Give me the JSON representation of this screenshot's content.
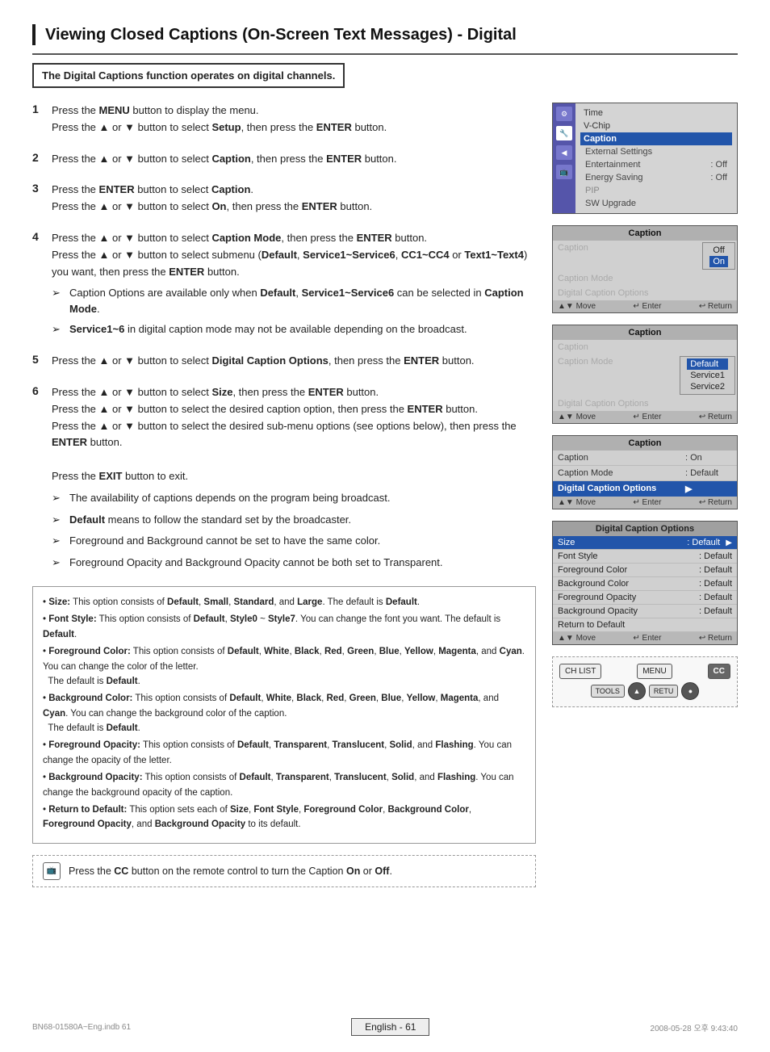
{
  "page": {
    "title": "Viewing Closed Captions (On-Screen Text Messages) - Digital",
    "subtitle": "The Digital Captions function operates on digital channels.",
    "page_number": "English - 61",
    "footer_left": "BN68-01580A~Eng.indb   61",
    "footer_right": "2008-05-28   오후 9:43:40"
  },
  "steps": [
    {
      "num": "1",
      "text": "Press the MENU button to display the menu.\nPress the ▲ or ▼ button to select Setup, then press the ENTER button."
    },
    {
      "num": "2",
      "text": "Press the ▲ or ▼ button to select Caption, then press the ENTER button."
    },
    {
      "num": "3",
      "text": "Press the ENTER button to select Caption.\nPress the ▲ or ▼ button to select On, then press the ENTER button."
    },
    {
      "num": "4",
      "text": "Press the ▲ or ▼ button to select Caption Mode, then press the ENTER button.\nPress the ▲ or ▼ button to select submenu (Default, Service1~Service6, CC1~CC4 or Text1~Text4) you want, then press the ENTER button.",
      "bullets": [
        "Caption Options are available only when Default, Service1~Service6 can be selected in Caption Mode.",
        "Service1~6 in digital caption mode may not be available depending on the broadcast."
      ]
    },
    {
      "num": "5",
      "text": "Press the ▲ or ▼ button to select Digital Caption Options, then press the ENTER button."
    },
    {
      "num": "6",
      "text": "Press the ▲ or ▼ button to select Size, then press the ENTER button.\nPress the ▲ or ▼ button to select the desired caption option, then press the ENTER button.\nPress the ▲ or ▼ button to select the desired sub-menu options (see options below), then press the ENTER button.",
      "extra": "Press the EXIT button to exit.",
      "bullets": [
        "The availability of captions depends on the program being broadcast.",
        "Default means to follow the standard set by the broadcaster.",
        "Foreground and Background cannot be set to have the same color.",
        "Foreground Opacity and Background Opacity cannot be both set to Transparent."
      ]
    }
  ],
  "info_box": {
    "items": [
      "• Size: This option consists of Default, Small, Standard, and Large. The default is Default.",
      "• Font Style: This option consists of Default, Style0 ~ Style7. You can change the font you want. The default is Default.",
      "• Foreground Color: This option consists of Default, White, Black, Red, Green, Blue, Yellow, Magenta, and Cyan. You can change the color of the letter. The default is Default.",
      "• Background Color: This option consists of Default, White, Black, Red, Green, Blue, Yellow, Magenta, and Cyan. You can change the background color of the caption. The default is Default.",
      "• Foreground Opacity: This option consists of Default, Transparent, Translucent, Solid, and Flashing. You can change the opacity of the letter.",
      "• Background Opacity: This option consists of Default, Transparent, Translucent, Solid, and Flashing. You can change the background opacity of the caption.",
      "• Return to Default: This option sets each of Size, Font Style, Foreground Color, Background Color, Foreground Opacity, and Background Opacity to its default."
    ]
  },
  "remote_note": "Press the CC button on the remote control to turn the Caption On or Off.",
  "setup_menu": {
    "title": "Setup",
    "items": [
      "Time",
      "V-Chip",
      "Caption",
      "External Settings",
      "Entertainment",
      "Energy Saving",
      "PIP",
      "SW Upgrade"
    ],
    "active": "Caption",
    "sub_items": [
      {
        "label": "External Settings",
        "value": ""
      },
      {
        "label": "Entertainment",
        "value": ": Off"
      },
      {
        "label": "Energy Saving",
        "value": ": Off"
      },
      {
        "label": "PIP",
        "value": ""
      },
      {
        "label": "SW Upgrade",
        "value": ""
      }
    ]
  },
  "caption_menu1": {
    "title": "Caption",
    "rows": [
      {
        "label": "Caption",
        "value": "",
        "dim": true
      },
      {
        "label": "Caption Mode",
        "value": "",
        "dim": true
      },
      {
        "label": "Digital Caption Options",
        "value": "",
        "dim": true
      }
    ],
    "popup": [
      "Off",
      "On"
    ],
    "popup_selected": "On"
  },
  "caption_menu2": {
    "title": "Caption",
    "rows": [
      {
        "label": "Caption",
        "value": "",
        "dim": true
      },
      {
        "label": "Caption Mode",
        "value": "",
        "dim": true
      },
      {
        "label": "Digital Caption Options",
        "value": "",
        "dim": true
      }
    ],
    "popup": [
      "Default",
      "Service1",
      "Service2"
    ],
    "popup_selected": "Default"
  },
  "caption_menu3": {
    "title": "Caption",
    "rows": [
      {
        "label": "Caption",
        "value": ": On"
      },
      {
        "label": "Caption Mode",
        "value": ": Default"
      },
      {
        "label": "Digital Caption Options",
        "value": "",
        "arrow": true
      }
    ]
  },
  "digital_caption_options": {
    "title": "Digital Caption Options",
    "rows": [
      {
        "label": "Size",
        "value": ": Default",
        "arrow": true,
        "highlight": true
      },
      {
        "label": "Font Style",
        "value": ": Default"
      },
      {
        "label": "Foreground Color",
        "value": ": Default"
      },
      {
        "label": "Background Color",
        "value": ": Default"
      },
      {
        "label": "Foreground Opacity",
        "value": ": Default"
      },
      {
        "label": "Background Opacity",
        "value": ": Default"
      },
      {
        "label": "Return to Default",
        "value": ""
      }
    ]
  },
  "nav_labels": {
    "move": "▲▼ Move",
    "enter": "↵ Enter",
    "return": "↩ Return"
  },
  "remote_buttons": {
    "ch_list": "CH LIST",
    "menu": "MENU",
    "cc": "CC",
    "tools": "TOOLS",
    "ret": "RETU",
    "up_arrow": "▲"
  }
}
